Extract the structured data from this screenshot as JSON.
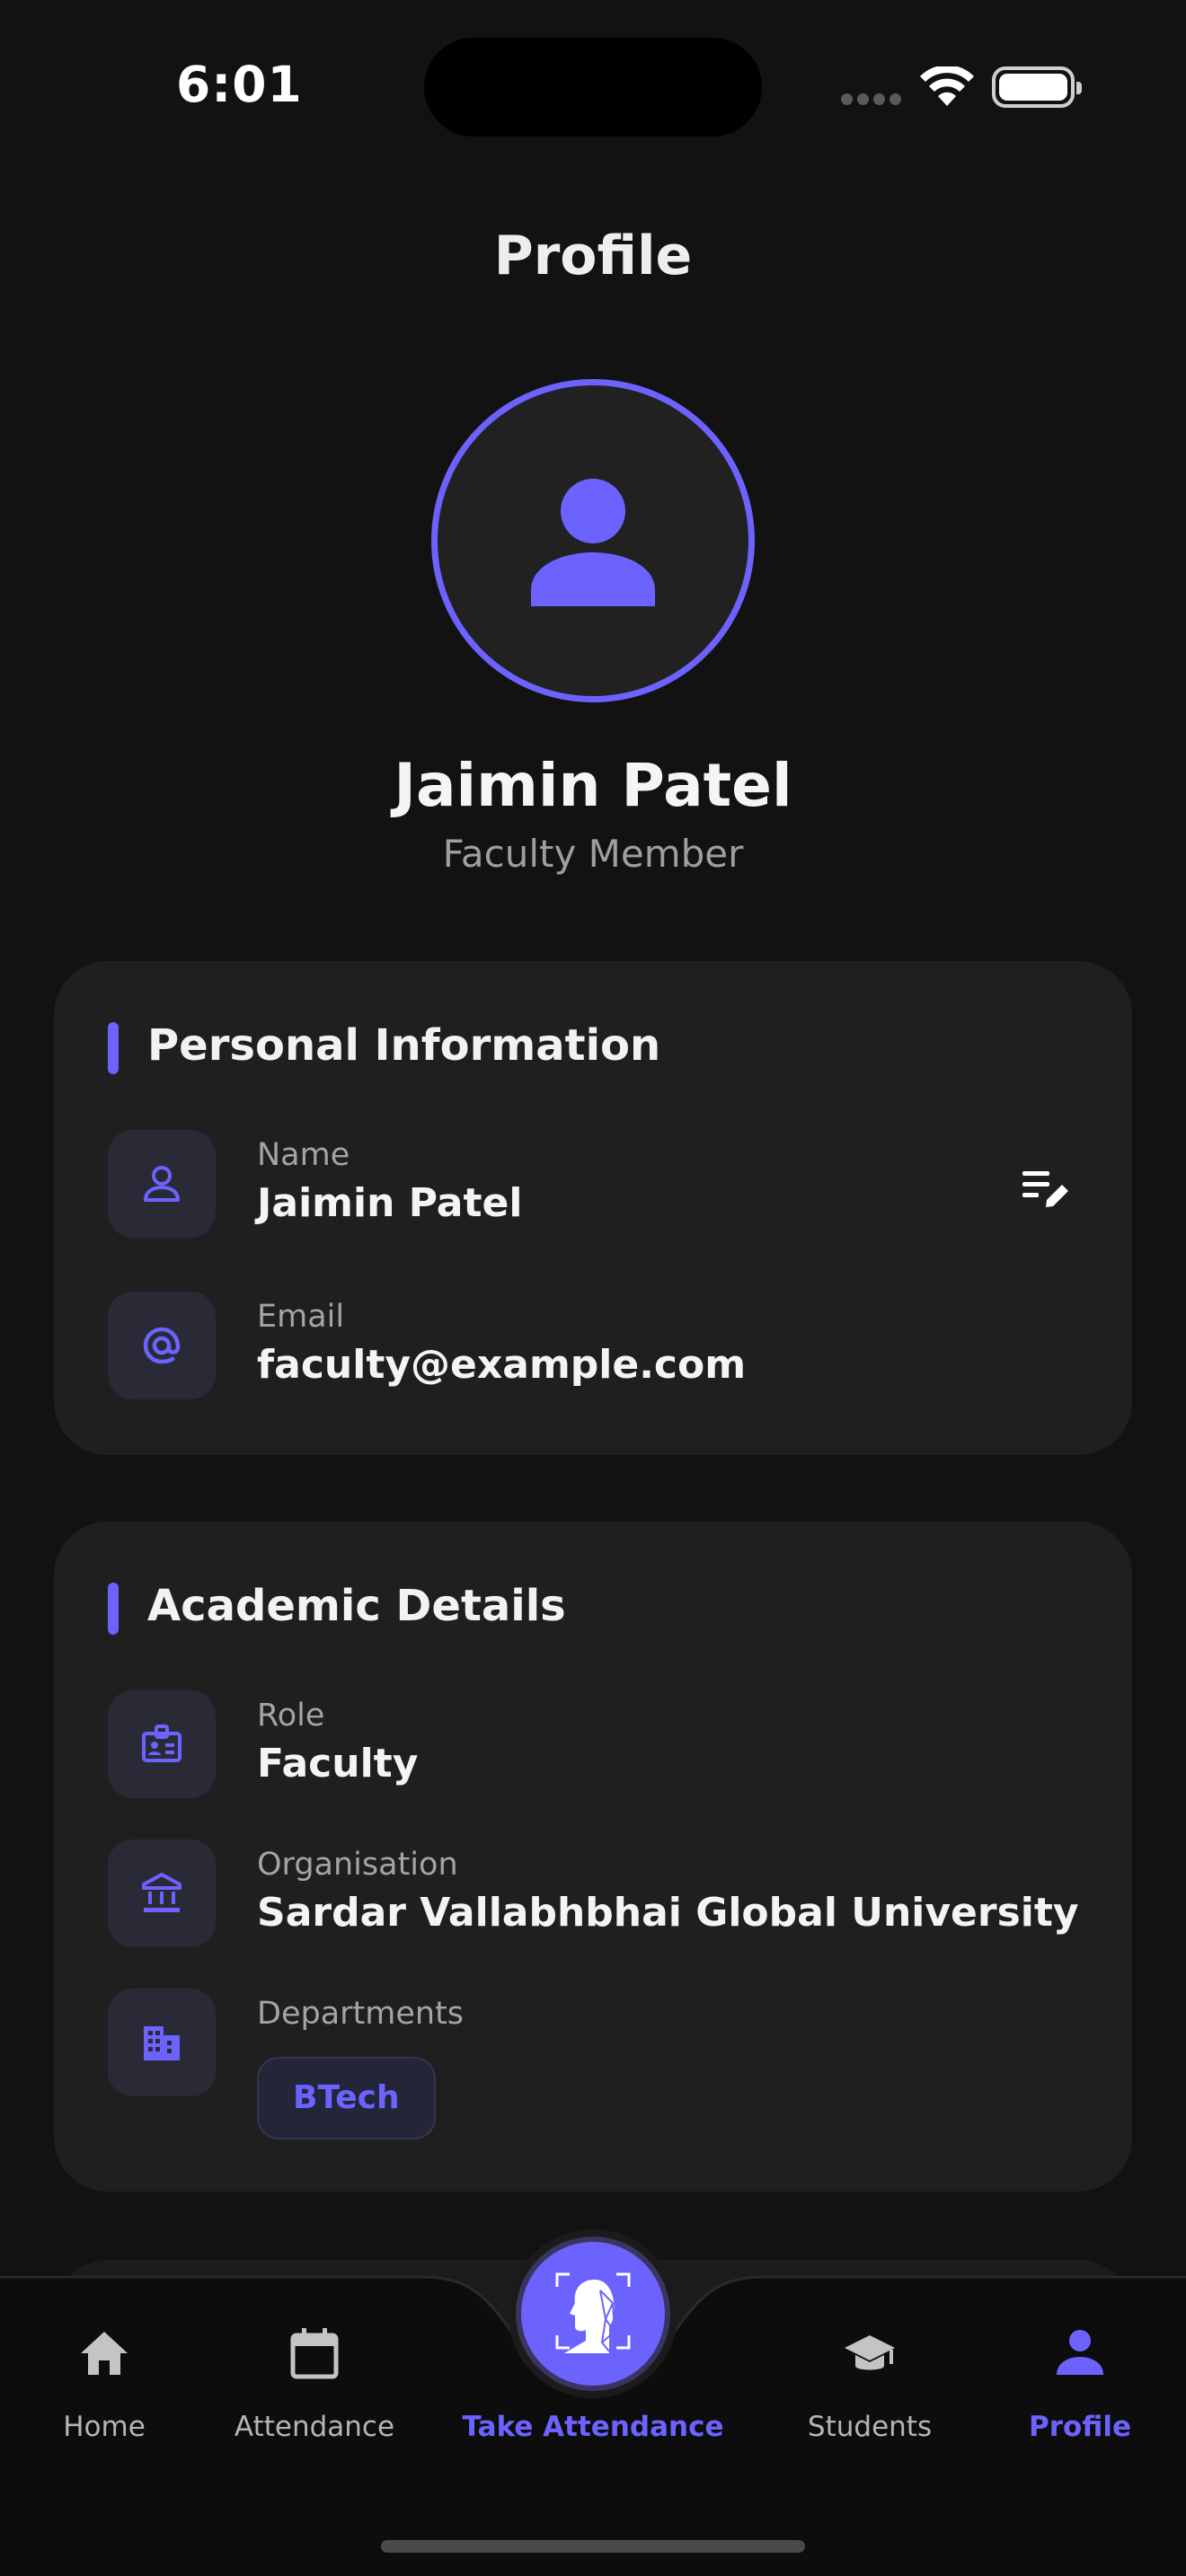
{
  "status_bar": {
    "time": "6:01"
  },
  "header": {
    "title": "Profile"
  },
  "profile": {
    "name": "Jaimin Patel",
    "role": "Faculty Member"
  },
  "personal": {
    "title": "Personal Information",
    "name_label": "Name",
    "name_value": "Jaimin Patel",
    "email_label": "Email",
    "email_value": "faculty@example.com"
  },
  "academic": {
    "title": "Academic Details",
    "role_label": "Role",
    "role_value": "Faculty",
    "org_label": "Organisation",
    "org_value": "Sardar Vallabhbhai Global University",
    "dept_label": "Departments",
    "departments": [
      "BTech"
    ]
  },
  "nav": {
    "home": "Home",
    "attendance": "Attendance",
    "take_attendance": "Take Attendance",
    "students": "Students",
    "profile": "Profile"
  },
  "colors": {
    "accent": "#6c63ff",
    "background": "#121212",
    "card": "#1f1f1f"
  }
}
